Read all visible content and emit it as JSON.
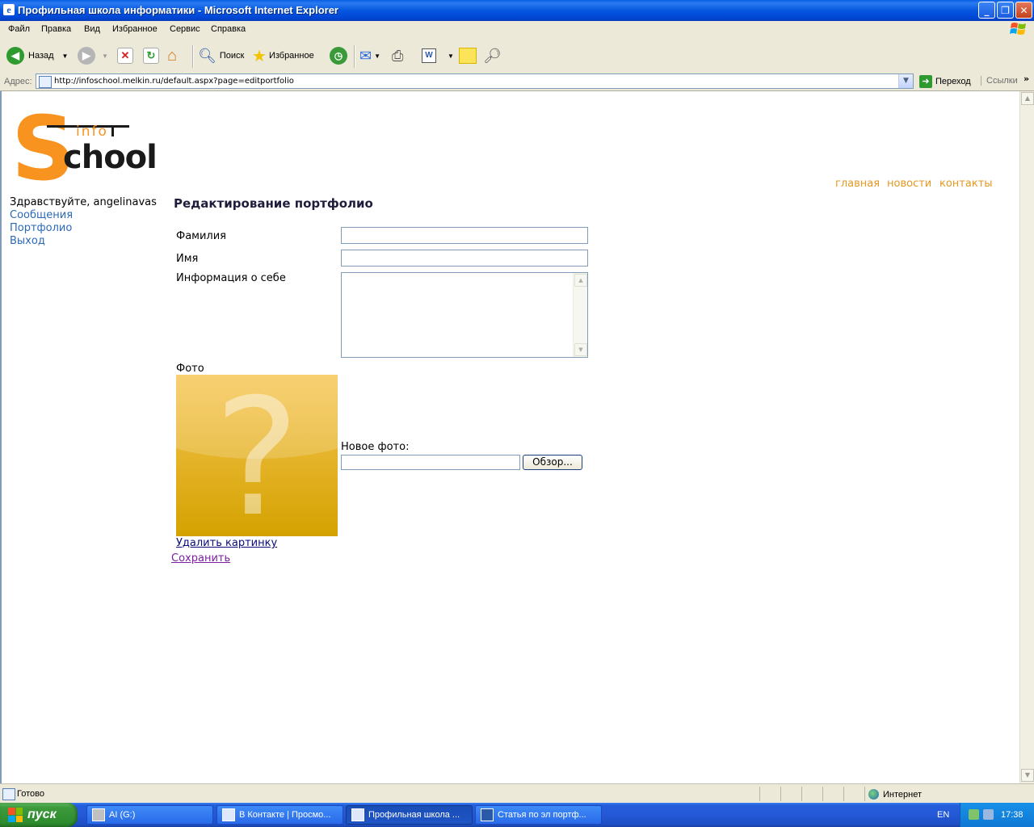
{
  "window": {
    "title": "Профильная школа информатики - Microsoft Internet Explorer"
  },
  "menu": [
    "Файл",
    "Правка",
    "Вид",
    "Избранное",
    "Сервис",
    "Справка"
  ],
  "toolbar": {
    "back": "Назад",
    "search": "Поиск",
    "favorites": "Избранное"
  },
  "address": {
    "label": "Адрес:",
    "url": "http://infoschool.melkin.ru/default.aspx?page=editportfolio",
    "go": "Переход",
    "links": "Ссылки"
  },
  "site": {
    "logo_top": "info",
    "logo_bottom": "chool",
    "logo_s": "S",
    "nav": [
      "главная",
      "новости",
      "контакты"
    ],
    "greeting": "Здравствуйте, angelinavas",
    "side": [
      "Сообщения",
      "Портфолио",
      "Выход"
    ],
    "page_title": "Редактирование портфолио",
    "form": {
      "last_name_label": "Фамилия",
      "last_name": "",
      "first_name_label": "Имя",
      "first_name": "",
      "about_label": "Информация о себе",
      "about": "",
      "photo_label": "Фото",
      "new_photo_label": "Новое фото:",
      "browse": "Обзор...",
      "delete_picture": "Удалить картинку",
      "save": "Сохранить"
    }
  },
  "status": {
    "text": "Готово",
    "zone": "Интернет"
  },
  "taskbar": {
    "start": "пуск",
    "tasks": [
      "AI (G:)",
      "В Контакте | Просмо...",
      "Профильная школа ...",
      "Статья по эл портф..."
    ],
    "lang": "EN",
    "clock": "17:38"
  },
  "colors": {
    "accent_orange": "#f7931e",
    "nav_orange": "#e59822",
    "link_blue": "#2b69b8",
    "xp_blue": "#0a5ee5"
  }
}
